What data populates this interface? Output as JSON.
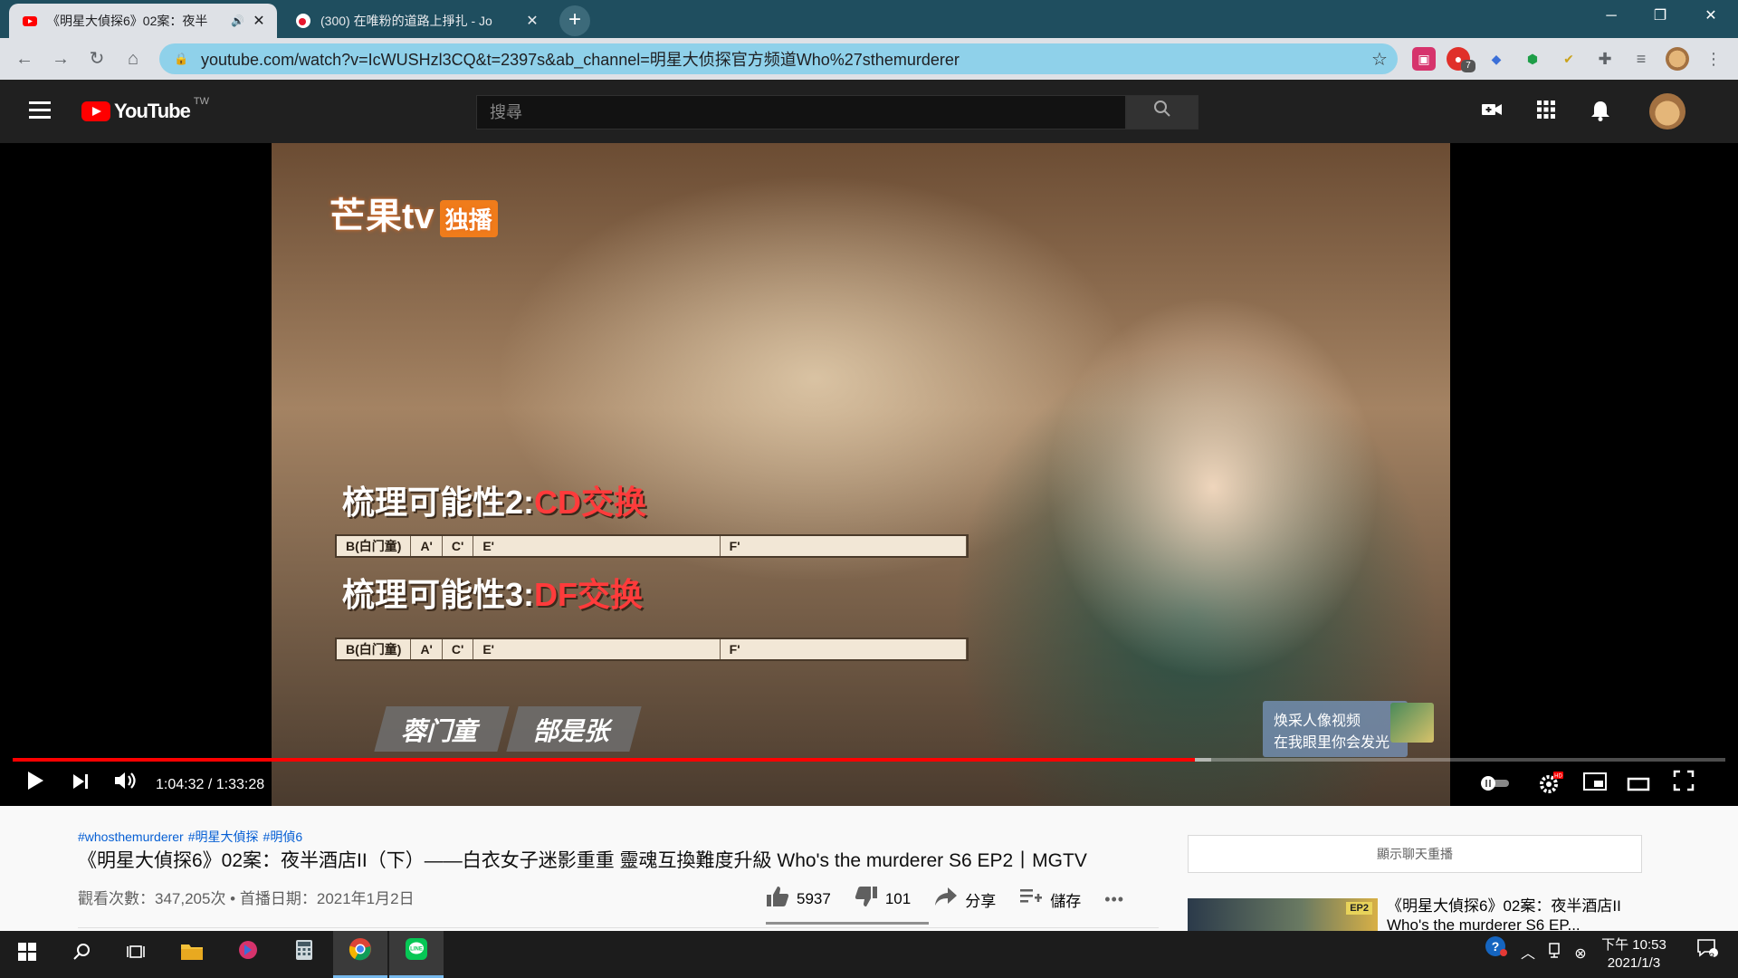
{
  "browser": {
    "tabs": [
      {
        "title": "《明星大偵探6》02案：夜半",
        "active": true
      },
      {
        "title": "(300) 在唯粉的道路上掙扎 - Jo",
        "active": false
      }
    ],
    "new_tab_label": "+",
    "window_controls": {
      "minimize": "─",
      "restore": "❐",
      "close": "✕"
    },
    "url": "youtube.com/watch?v=IcWUSHzl3CQ&t=2397s&ab_channel=明星大侦探官方频道Who%27sthemurderer",
    "extension_badge": "7"
  },
  "youtube": {
    "logo_text": "YouTube",
    "country_code": "TW",
    "search_placeholder": "搜尋"
  },
  "video": {
    "watermark": "芒果tv",
    "watermark_badge": "独播",
    "subtitle_1_prefix": "梳理可能性2:",
    "subtitle_1_highlight": "CD交换",
    "subtitle_2_prefix": "梳理可能性3:",
    "subtitle_2_highlight": "DF交换",
    "strip_1": [
      "B(白门童)",
      "A'",
      "C'",
      "E'",
      "F'"
    ],
    "strip_2": [
      "B(白门童)",
      "A'",
      "C'",
      "E'",
      "F'"
    ],
    "nameplate": [
      "蓉门童",
      "郜是张"
    ],
    "ad_line_1": "焕采人像视频",
    "ad_line_2": "在我眼里你会发光",
    "time_current": "1:04:32",
    "time_total": "1:33:28",
    "progress_fraction": 0.6905,
    "buffered_fraction": 0.7
  },
  "page": {
    "hashtags": [
      "#whosthemurderer",
      "#明星大偵探",
      "#明偵6"
    ],
    "title": "《明星大偵探6》02案：夜半酒店II（下）——白衣女子迷影重重 靈魂互換難度升級 Who's the murderer S6 EP2丨MGTV",
    "views": "觀看次數：347,205次",
    "premiere": "首播日期：2021年1月2日",
    "likes": "5937",
    "dislikes": "101",
    "share_label": "分享",
    "save_label": "儲存",
    "more_label": "•••",
    "show_chat_replay": "顯示聊天重播",
    "rec_title": "《明星大偵探6》02案：夜半酒店II Who's the murderer S6 EP...",
    "rec_badge": "EP2"
  },
  "taskbar": {
    "clock_time": "下午 10:53",
    "clock_date": "2021/1/3",
    "notification_count": "3"
  }
}
